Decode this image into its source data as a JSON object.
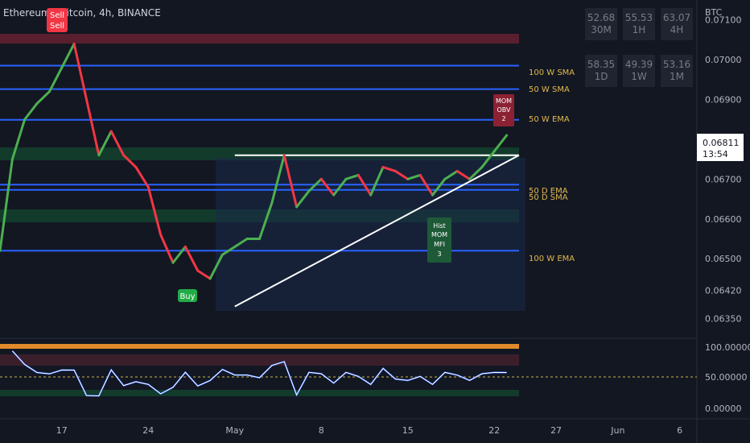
{
  "header": {
    "title": "Ethereum / Bitcoin, 4h, BINANCE",
    "currency": "BTC"
  },
  "rsi_table": [
    {
      "value": "52.68",
      "tf": "30M"
    },
    {
      "value": "55.53",
      "tf": "1H"
    },
    {
      "value": "63.07",
      "tf": "4H"
    },
    {
      "value": "58.35",
      "tf": "1D"
    },
    {
      "value": "49.39",
      "tf": "1W"
    },
    {
      "value": "53.16",
      "tf": "1M"
    }
  ],
  "price_tag": {
    "value": "0.06811",
    "countdown": "13:54"
  },
  "lower_axis": [
    "100.00000",
    "50.00000",
    "0.00000"
  ],
  "labels": {
    "sell1": "Sell",
    "sell2": "Sell",
    "buy": "Buy",
    "mom_obv": [
      "MOM",
      "OBV",
      "2"
    ],
    "hist_mom": [
      "Hist",
      "MOM",
      "MFI",
      "3"
    ],
    "sma100w": "100 W SMA",
    "sma50w": "50 W SMA",
    "ema50w": "50 W EMA",
    "ema50d": "50 D EMA",
    "sma50d": "50 D SMA",
    "ema100w": "100 W EMA"
  },
  "colors": {
    "background": "#131722",
    "up": "#4caf50",
    "down": "#f23645",
    "ma": "#2962ff",
    "label": "#e0b94d"
  },
  "chart_data": {
    "type": "line",
    "symbol": "Ethereum / Bitcoin",
    "interval": "4h",
    "exchange": "BINANCE",
    "y_ticks": [
      0.071,
      0.07,
      0.069,
      0.067,
      0.066,
      0.065,
      0.0642,
      0.0635
    ],
    "y_tick_labels": [
      "0.07100",
      "0.07000",
      "0.06900",
      "0.06700",
      "0.06600",
      "0.06500",
      "0.06420",
      "0.06350"
    ],
    "x_tick_labels": [
      "17",
      "24",
      "May",
      "8",
      "15",
      "22",
      "27",
      "Jun",
      "6"
    ],
    "x_tick_days": [
      17,
      24,
      31,
      38,
      45,
      52,
      57,
      62,
      67
    ],
    "ylim": [
      0.063,
      0.0715
    ],
    "price": {
      "x": [
        12,
        13,
        14,
        15,
        16,
        17,
        18,
        19,
        20,
        21,
        22,
        23,
        24,
        25,
        26,
        27,
        28,
        29,
        30,
        31,
        32,
        33,
        34,
        35,
        36,
        37,
        38,
        39,
        40,
        41,
        42,
        43,
        44,
        45,
        46,
        47,
        48,
        49,
        50,
        51,
        52,
        53
      ],
      "close": [
        0.0652,
        0.0675,
        0.0685,
        0.0689,
        0.0692,
        0.0698,
        0.0704,
        0.069,
        0.0676,
        0.0682,
        0.0676,
        0.0673,
        0.0668,
        0.0656,
        0.0649,
        0.0653,
        0.0647,
        0.0645,
        0.0651,
        0.0653,
        0.0655,
        0.0655,
        0.0664,
        0.0676,
        0.0663,
        0.0667,
        0.067,
        0.0666,
        0.067,
        0.0671,
        0.0666,
        0.0673,
        0.0672,
        0.067,
        0.0671,
        0.0666,
        0.067,
        0.0672,
        0.067,
        0.0673,
        0.0677,
        0.0681
      ]
    },
    "moving_averages": [
      {
        "name": "100 W SMA",
        "value": 0.06985
      },
      {
        "name": "50 W SMA",
        "value": 0.06926
      },
      {
        "name": "50 W EMA",
        "value": 0.06849
      },
      {
        "name": "50 D EMA",
        "value": 0.06686
      },
      {
        "name": "50 D SMA",
        "value": 0.06673
      },
      {
        "name": "100 W EMA",
        "value": 0.0652
      }
    ],
    "trendline": {
      "x": [
        31,
        54
      ],
      "y": [
        0.0638,
        0.0676
      ]
    },
    "resistance": 0.0676,
    "signals": [
      {
        "label": "Sell",
        "day": 19,
        "price": 0.071
      },
      {
        "label": "Buy",
        "day": 26,
        "price": 0.0642
      }
    ]
  }
}
